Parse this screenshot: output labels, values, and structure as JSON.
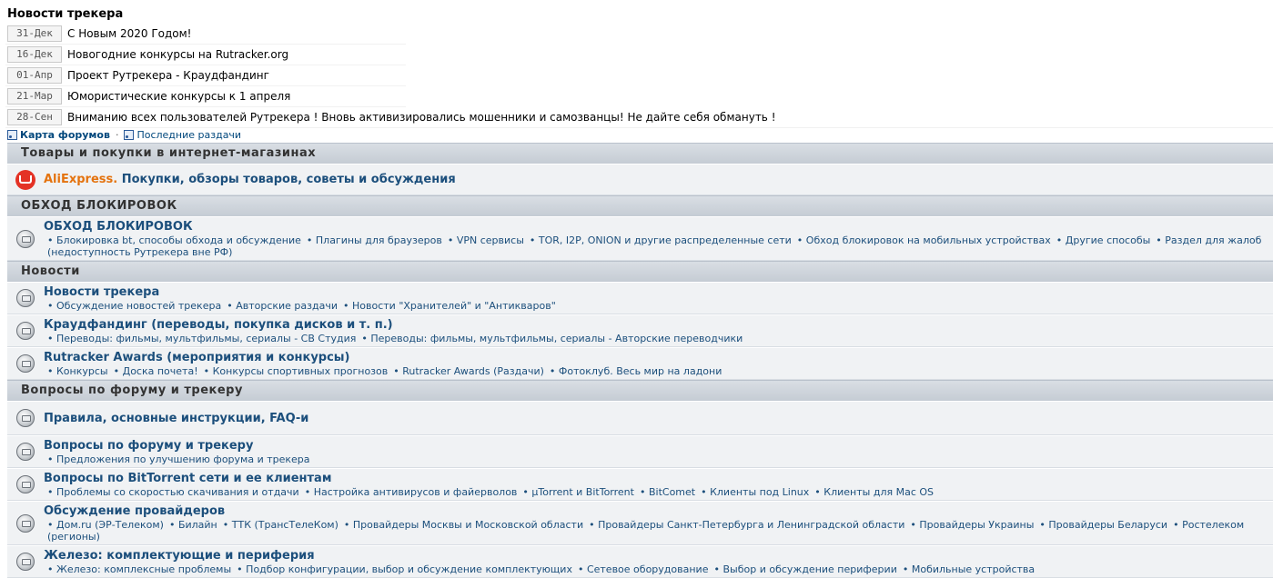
{
  "news": {
    "title": "Новости трекера",
    "items": [
      {
        "date": "31-Дек",
        "text": "С Новым 2020 Годом!"
      },
      {
        "date": "16-Дек",
        "text": "Новогодние конкурсы на Rutracker.org"
      },
      {
        "date": "01-Апр",
        "text": "Проект Рутрекера - Краудфандинг"
      },
      {
        "date": "21-Мар",
        "text": "Юмористические конкурсы к 1 апреля"
      },
      {
        "date": "28-Сен",
        "text": "Вниманию всех пользователей Рутрекера ! Вновь активизировались мошенники и самозванцы! Не дайте себя обмануть !"
      }
    ]
  },
  "links": {
    "forum_map": "Карта форумов",
    "separator": "·",
    "latest": "Последние раздачи"
  },
  "categories": {
    "shop": {
      "title": "Товары и покупки в интернет-магазинах",
      "ali_brand": "AliExpress.",
      "ali_title": " Покупки, обзоры товаров, советы и обсуждения"
    },
    "bypass": {
      "title": "ОБХОД БЛОКИРОВОК",
      "forum": "ОБХОД БЛОКИРОВОК",
      "subs": [
        "Блокировка bt, способы обхода и обсуждение",
        "Плагины для браузеров",
        "VPN сервисы",
        "TOR, I2P, ONION и другие распределенные сети",
        "Обход блокировок на мобильных устройствах",
        "Другие способы",
        "Раздел для жалоб (недоступность Рутрекера вне РФ)"
      ]
    },
    "news": {
      "title": "Новости",
      "forums": [
        {
          "title": "Новости трекера",
          "subs": [
            "Обсуждение новостей трекера",
            "Авторские раздачи",
            "Новости \"Хранителей\" и \"Антикваров\""
          ]
        },
        {
          "title": "Краудфандинг (переводы, покупка дисков и т. п.)",
          "subs": [
            "Переводы: фильмы, мультфильмы, сериалы - СВ Студия",
            "Переводы: фильмы, мультфильмы, сериалы - Авторские переводчики"
          ]
        },
        {
          "title": "Rutracker Awards (мероприятия и конкурсы)",
          "subs": [
            "Конкурсы",
            "Доска почета!",
            "Конкурсы спортивных прогнозов",
            "Rutracker Awards (Раздачи)",
            "Фотоклуб. Весь мир на ладони"
          ]
        }
      ]
    },
    "questions": {
      "title": "Вопросы по форуму и трекеру",
      "forums": [
        {
          "title": "Правила, основные инструкции, FAQ-и",
          "subs": []
        },
        {
          "title": "Вопросы по форуму и трекеру",
          "subs": [
            "Предложения по улучшению форума и трекера"
          ]
        },
        {
          "title": "Вопросы по BitTorrent сети и ее клиентам",
          "subs": [
            "Проблемы со скоростью скачивания и отдачи",
            "Настройка антивирусов и файерволов",
            "µTorrent и BitTorrent",
            "BitComet",
            "Клиенты под Linux",
            "Клиенты для Mac OS"
          ]
        },
        {
          "title": "Обсуждение провайдеров",
          "subs": [
            "Дом.ru (ЭР-Телеком)",
            "Билайн",
            "ТТК (ТрансТелеКом)",
            "Провайдеры Москвы и Московской области",
            "Провайдеры Санкт-Петербурга и Ленинградской области",
            "Провайдеры Украины",
            "Провайдеры Беларуси",
            "Ростелеком (регионы)"
          ]
        },
        {
          "title": "Железо: комплектующие и периферия",
          "subs": [
            "Железо: комплексные проблемы",
            "Подбор конфигурации, выбор и обсуждение комплектующих",
            "Сетевое оборудование",
            "Выбор и обсуждение периферии",
            "Мобильные устройства"
          ]
        }
      ]
    }
  }
}
